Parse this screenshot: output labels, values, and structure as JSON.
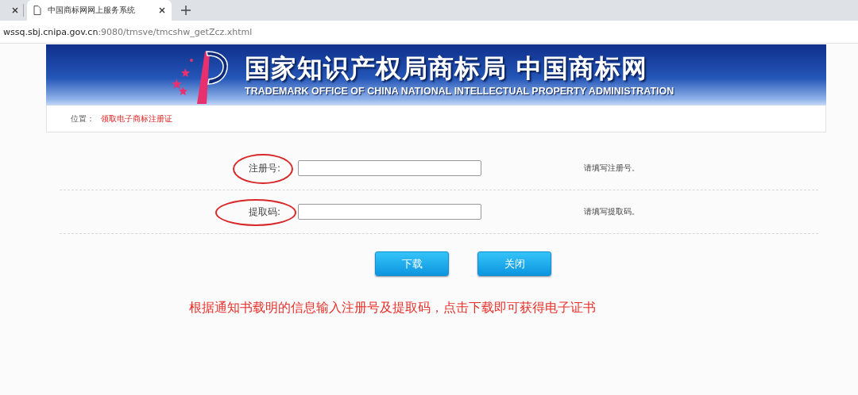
{
  "browser": {
    "tabs": [
      {
        "selected": false
      },
      {
        "title": "中国商标网网上服务系统",
        "selected": true
      }
    ],
    "address": {
      "host": "wssq.sbj.cnipa.gov.cn",
      "rest": ":9080/tmsve/tmcshw_getZcz.xhtml"
    }
  },
  "banner": {
    "title": "国家知识产权局商标局 中国商标网",
    "subtitle": "TRADEMARK OFFICE OF CHINA NATIONAL INTELLECTUAL PROPERTY ADMINISTRATION"
  },
  "breadcrumb": {
    "label": "位置：",
    "current": "领取电子商标注册证"
  },
  "fields": [
    {
      "label": "注册号:",
      "hint": "请填写注册号。",
      "circled": true
    },
    {
      "label": "提取码:",
      "hint": "请填写提取码。",
      "circled": true
    }
  ],
  "buttons": [
    "下载",
    "关闭"
  ],
  "note": "根据通知书载明的信息输入注册号及提取码，点击下载即可获得电子证书"
}
